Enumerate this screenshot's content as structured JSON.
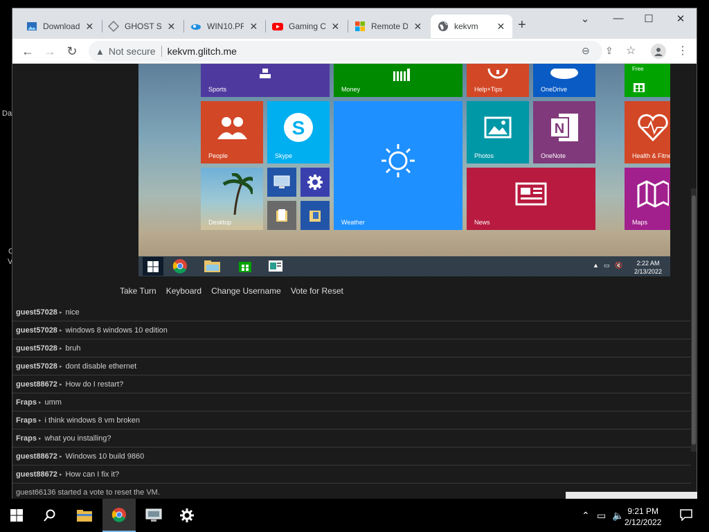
{
  "desktop_fragments": [
    "Da",
    "C",
    "V"
  ],
  "tabs": [
    {
      "label": "Download",
      "icon": "image-icon"
    },
    {
      "label": "GHOST SP",
      "icon": "ghost-icon"
    },
    {
      "label": "WIN10.PR",
      "icon": "cloud-icon"
    },
    {
      "label": "Gaming C",
      "icon": "youtube-icon"
    },
    {
      "label": "Remote D",
      "icon": "microsoft-icon"
    },
    {
      "label": "kekvm",
      "icon": "globe-icon"
    }
  ],
  "omnibox": {
    "security": "Not secure",
    "url": "kekvm.glitch.me"
  },
  "vm": {
    "tiles": [
      {
        "name": "Sports",
        "color": "#4e3a9e"
      },
      {
        "name": "Money",
        "color": "#008a00"
      },
      {
        "name": "Help+Tips",
        "color": "#d24726"
      },
      {
        "name": "OneDrive",
        "color": "#0a5bc4"
      },
      {
        "name": "Free",
        "color": "#00a300"
      },
      {
        "name": "People",
        "color": "#d24726"
      },
      {
        "name": "Skype",
        "color": "#00aff0"
      },
      {
        "name": "Weather",
        "color": "#1e90ff"
      },
      {
        "name": "Photos",
        "color": "#0097a7"
      },
      {
        "name": "OneNote",
        "color": "#80397b"
      },
      {
        "name": "Health & Fitness",
        "color": "#d24726"
      },
      {
        "name": "Desktop",
        "color": "#3a7f8a"
      },
      {
        "name": "News",
        "color": "#b81b3f"
      },
      {
        "name": "Maps",
        "color": "#a1208d"
      }
    ],
    "clock": {
      "time": "2:22 AM",
      "date": "2/13/2022"
    }
  },
  "controls": {
    "take_turn": "Take Turn",
    "keyboard": "Keyboard",
    "change_username": "Change Username",
    "vote_reset": "Vote for Reset"
  },
  "chat": {
    "messages": [
      {
        "user": "guest57028",
        "text": "nice"
      },
      {
        "user": "guest57028",
        "text": "windows 8 windows 10 edition"
      },
      {
        "user": "guest57028",
        "text": "bruh"
      },
      {
        "user": "guest57028",
        "text": "dont disable ethernet"
      },
      {
        "user": "guest88672",
        "text": "How do I restart?"
      },
      {
        "user": "Fraps",
        "text": "umm"
      },
      {
        "user": "Fraps",
        "text": "i think windows 8 vm broken"
      },
      {
        "user": "Fraps",
        "text": "what you installing?"
      },
      {
        "user": "guest88672",
        "text": "Windows 10 build 9860"
      },
      {
        "user": "guest88672",
        "text": "How can I fix it?"
      }
    ],
    "system": "guest66136 started a vote to reset the VM."
  },
  "host": {
    "clock": {
      "time": "9:21 PM",
      "date": "2/12/2022"
    }
  }
}
